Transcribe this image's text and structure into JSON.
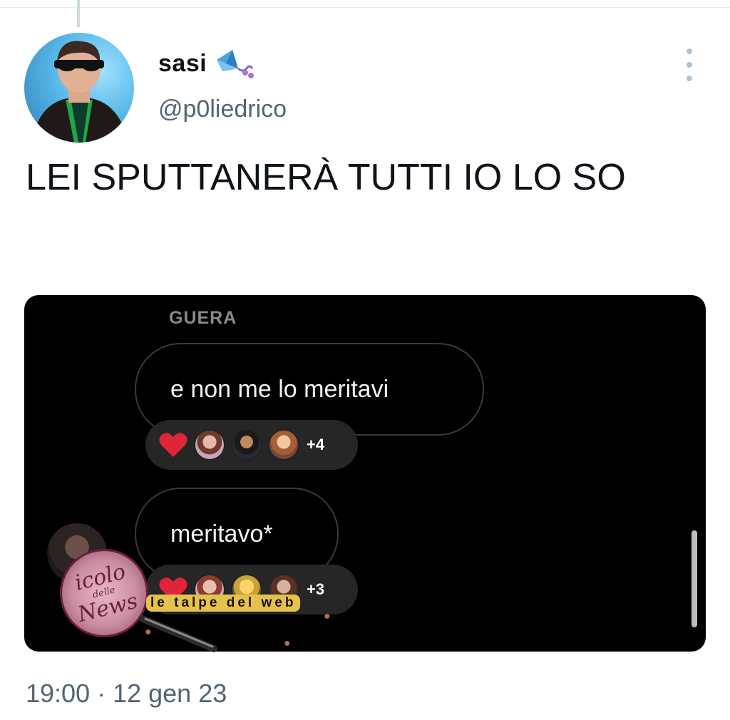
{
  "tweet": {
    "display_name": "sasi",
    "handle": "@p0liedrico",
    "text": "LEI SPUTTANERÀ TUTTI IO LO SO",
    "timestamp": "19:00 · 12 gen 23",
    "name_emoji_icon": "kite-icon"
  },
  "media": {
    "sender": "GUERA",
    "messages": [
      {
        "text": "e non me lo meritavi",
        "reaction": "heart-icon",
        "reaction_more": "+4"
      },
      {
        "text": "meritavo*",
        "reaction": "heart-icon",
        "reaction_more": "+3"
      }
    ]
  },
  "watermark": {
    "badge_top": "icolo",
    "badge_mid": "delle",
    "badge_bottom": "News",
    "text": "le talpe del web"
  },
  "colors": {
    "text": "#0f1419",
    "secondary": "#536471",
    "media_bg": "#000000",
    "heart": "#e0243a",
    "watermark": "#6b1f3a"
  }
}
